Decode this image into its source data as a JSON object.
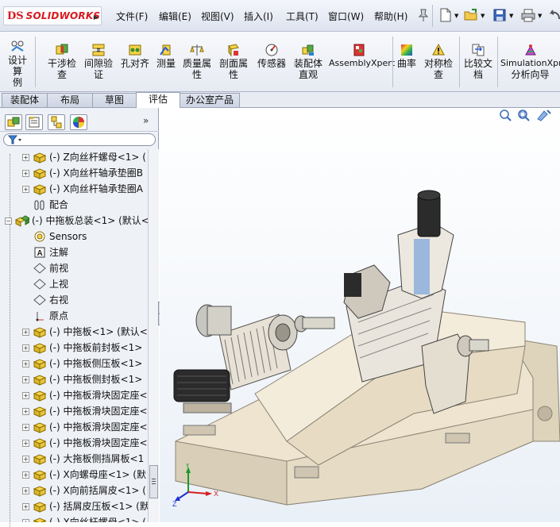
{
  "app": {
    "logo_mark": "DS",
    "logo_text": "SOLIDWORKS"
  },
  "menu": [
    "文件(F)",
    "编辑(E)",
    "视图(V)",
    "插入(I)",
    "工具(T)",
    "窗口(W)",
    "帮助(H)"
  ],
  "commands": [
    {
      "line1": "设计算",
      "line2": "例",
      "icon": "design-study-icon"
    },
    {
      "line1": "干涉检",
      "line2": "查",
      "icon": "interference-icon"
    },
    {
      "line1": "间隙验",
      "line2": "证",
      "icon": "clearance-icon"
    },
    {
      "line1": "孔对齐",
      "line2": "",
      "icon": "hole-align-icon"
    },
    {
      "line1": "测量",
      "line2": "",
      "icon": "measure-icon"
    },
    {
      "line1": "质量属",
      "line2": "性",
      "icon": "mass-properties-icon"
    },
    {
      "line1": "剖面属",
      "line2": "性",
      "icon": "section-properties-icon"
    },
    {
      "line1": "传感器",
      "line2": "",
      "icon": "sensor-icon"
    },
    {
      "line1": "装配体",
      "line2": "直观",
      "icon": "assembly-visualization-icon"
    },
    {
      "line1": "AssemblyXpert",
      "line2": "",
      "icon": "assemblyxpert-icon"
    },
    {
      "line1": "曲率",
      "line2": "",
      "icon": "curvature-icon"
    },
    {
      "line1": "对称检",
      "line2": "查",
      "icon": "symmetry-check-icon"
    },
    {
      "line1": "比较文",
      "line2": "档",
      "icon": "compare-icon"
    },
    {
      "line1": "SimulationXpres",
      "line2": "分析向导",
      "icon": "simulation-icon"
    }
  ],
  "tabs": [
    "装配体",
    "布局",
    "草图",
    "评估",
    "办公室产品"
  ],
  "active_tab": "评估",
  "tree": [
    {
      "label": "(-) Z向丝杆螺母<1> (",
      "indent": 2,
      "icon": "part-icon"
    },
    {
      "label": "(-) X向丝杆轴承垫圈B",
      "indent": 2,
      "icon": "part-icon"
    },
    {
      "label": "(-) X向丝杆轴承垫圈A",
      "indent": 2,
      "icon": "part-icon"
    },
    {
      "label": "配合",
      "indent": 2,
      "icon": "mates-icon"
    },
    {
      "label": "(-) 中拖板总装<1> (默认<",
      "indent": 1,
      "icon": "assembly-icon"
    },
    {
      "label": "Sensors",
      "indent": 2,
      "icon": "sensors-icon"
    },
    {
      "label": "注解",
      "indent": 2,
      "icon": "annotation-icon"
    },
    {
      "label": "前视",
      "indent": 2,
      "icon": "plane-icon"
    },
    {
      "label": "上视",
      "indent": 2,
      "icon": "plane-icon"
    },
    {
      "label": "右视",
      "indent": 2,
      "icon": "plane-icon"
    },
    {
      "label": "原点",
      "indent": 2,
      "icon": "origin-icon"
    },
    {
      "label": "(-) 中拖板<1> (默认<",
      "indent": 2,
      "icon": "part-icon"
    },
    {
      "label": "(-) 中拖板前封板<1>",
      "indent": 2,
      "icon": "part-icon"
    },
    {
      "label": "(-) 中拖板侧压板<1>",
      "indent": 2,
      "icon": "part-icon"
    },
    {
      "label": "(-) 中拖板侧封板<1>",
      "indent": 2,
      "icon": "part-icon"
    },
    {
      "label": "(-) 中拖板滑块固定座<",
      "indent": 2,
      "icon": "part-icon"
    },
    {
      "label": "(-) 中拖板滑块固定座<",
      "indent": 2,
      "icon": "part-icon"
    },
    {
      "label": "(-) 中拖板滑块固定座<",
      "indent": 2,
      "icon": "part-icon"
    },
    {
      "label": "(-) 中拖板滑块固定座<",
      "indent": 2,
      "icon": "part-icon"
    },
    {
      "label": "(-) 大拖板侧挡屑板<1",
      "indent": 2,
      "icon": "part-icon"
    },
    {
      "label": "(-) X向螺母座<1> (默",
      "indent": 2,
      "icon": "part-icon"
    },
    {
      "label": "(-) X向前括屑皮<1> (",
      "indent": 2,
      "icon": "part-icon"
    },
    {
      "label": "(-) 括屑皮压板<1> (默",
      "indent": 2,
      "icon": "part-icon"
    },
    {
      "label": "(-) X向丝杆螺母<1> (",
      "indent": 2,
      "icon": "part-icon"
    }
  ],
  "triad": {
    "x": "X",
    "y": "Y",
    "z": "Z"
  },
  "colors": {
    "accent": "#d71920",
    "machine_body": "#efe6d2",
    "machine_dark": "#2b2b2b"
  }
}
